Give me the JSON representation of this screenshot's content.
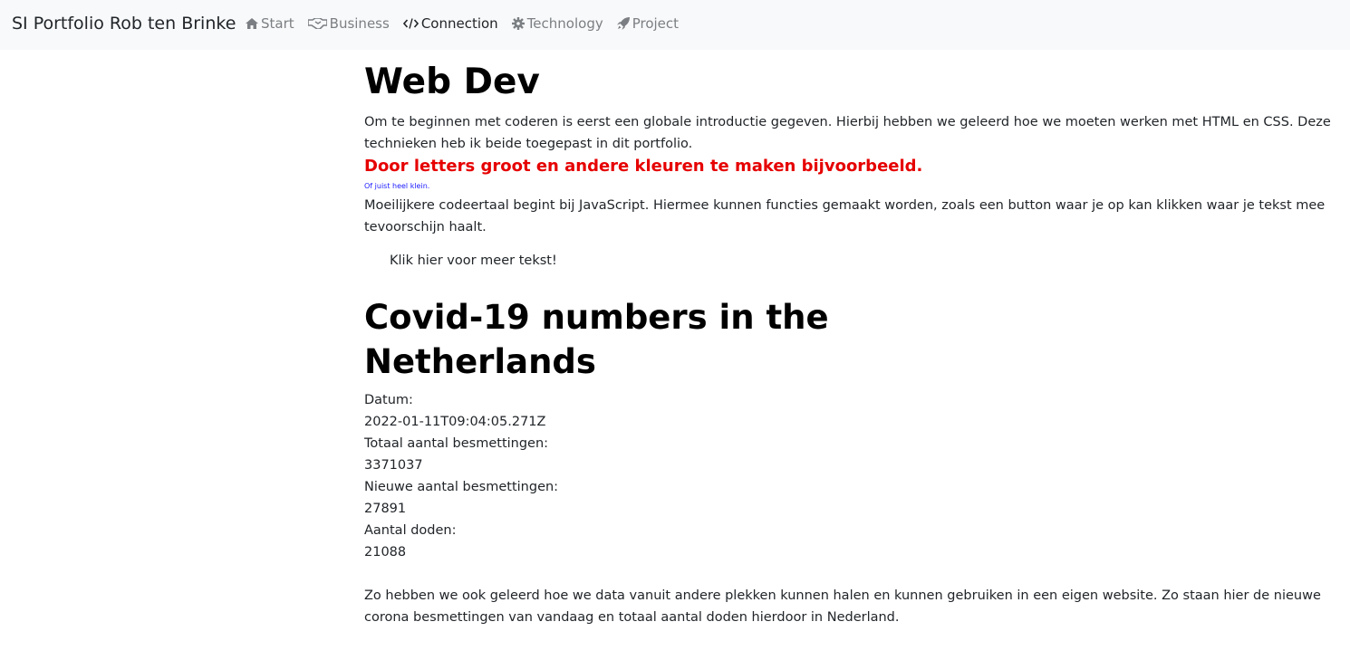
{
  "nav": {
    "brand": "SI Portfolio Rob ten Brinke",
    "items": [
      {
        "label": "Start",
        "icon": "home-icon",
        "active": false
      },
      {
        "label": "Business",
        "icon": "handshake-icon",
        "active": false
      },
      {
        "label": "Connection",
        "icon": "code-icon",
        "active": true
      },
      {
        "label": "Technology",
        "icon": "gear-icon",
        "active": false
      },
      {
        "label": "Project",
        "icon": "rocket-icon",
        "active": false
      }
    ]
  },
  "webdev": {
    "title": "Web Dev",
    "intro": "Om te beginnen met coderen is eerst een globale introductie gegeven. Hierbij hebben we geleerd hoe we moeten werken met HTML en CSS. Deze technieken heb ik beide toegepast in dit portfolio.",
    "big_red": "Door letters groot en andere kleuren te maken bijvoorbeeld.",
    "tiny_blue": "Of juist heel klein.",
    "js_text": "Moeilijkere codeertaal begint bij JavaScript. Hiermee kunnen functies gemaakt worden, zoals een button waar je op kan klikken waar je tekst mee tevoorschijn haalt.",
    "more_button": "Klik hier voor meer tekst!"
  },
  "covid": {
    "title": "Covid-19 numbers in the Netherlands",
    "date_label": "Datum:",
    "date_value": "2022-01-11T09:04:05.271Z",
    "total_label": "Totaal aantal besmettingen:",
    "total_value": "3371037",
    "new_label": "Nieuwe aantal besmettingen:",
    "new_value": "27891",
    "deaths_label": "Aantal doden:",
    "deaths_value": "21088",
    "closing": "Zo hebben we ook geleerd hoe we data vanuit andere plekken kunnen halen en kunnen gebruiken in een eigen website. Zo staan hier de nieuwe corona besmettingen van vandaag en totaal aantal doden hierdoor in Nederland."
  },
  "colors": {
    "navbar_bg": "#f8f9fa",
    "red_text": "#e60000",
    "blue_text": "#1a1aff",
    "nav_muted": "#7b7f83",
    "nav_active": "#212529"
  }
}
